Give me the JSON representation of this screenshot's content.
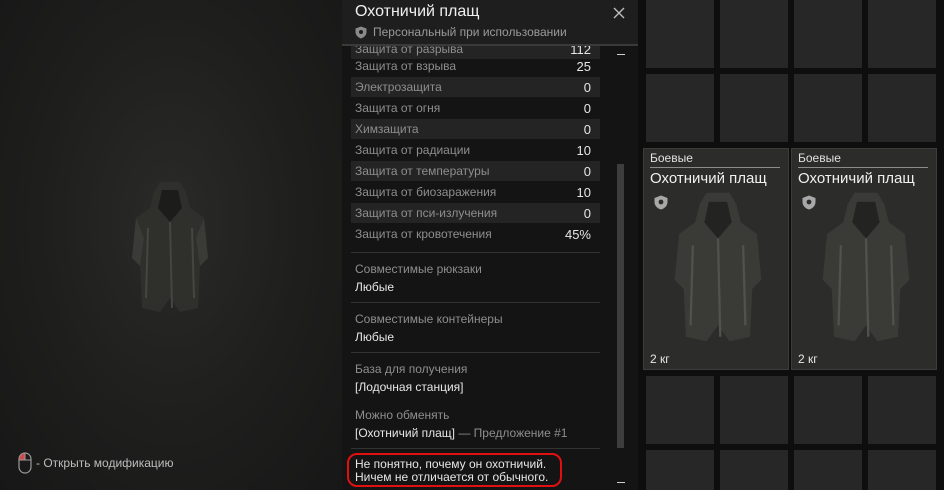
{
  "preview": {
    "mouse_hint": "- Открыть модификацию"
  },
  "panel": {
    "title": "Охотничий плащ",
    "subtitle": "Персональный при использовании",
    "stats": [
      {
        "name": "Защита от разрыва",
        "value": "112"
      },
      {
        "name": "Защита от взрыва",
        "value": "25"
      },
      {
        "name": "Электрозащита",
        "value": "0"
      },
      {
        "name": "Защита от огня",
        "value": "0"
      },
      {
        "name": "Химзащита",
        "value": "0"
      },
      {
        "name": "Защита от радиации",
        "value": "10"
      },
      {
        "name": "Защита от температуры",
        "value": "0"
      },
      {
        "name": "Защита от биозаражения",
        "value": "10"
      },
      {
        "name": "Защита от пси-излучения",
        "value": "0"
      },
      {
        "name": "Защита от кровотечения",
        "value": "45%"
      }
    ],
    "backpacks": {
      "label": "Совместимые рюкзаки",
      "value": "Любые"
    },
    "containers": {
      "label": "Совместимые контейнеры",
      "value": "Любые"
    },
    "source": {
      "label": "База для получения",
      "value": "[Лодочная станция]"
    },
    "exchange": {
      "label": "Можно обменять",
      "value": "[Охотничий плащ]",
      "suffix": " — Предложение #1"
    },
    "note": {
      "line1": "Не понятно, почему он охотничий.",
      "line2": "Ничем не отличается от обычного."
    }
  },
  "inventory": {
    "items": [
      {
        "category": "Боевые",
        "name": "Охотничий плащ",
        "weight": "2 кг"
      },
      {
        "category": "Боевые",
        "name": "Охотничий плащ",
        "weight": "2 кг"
      }
    ]
  },
  "colors": {
    "accent_red": "#e01010",
    "panel_bg": "#141414",
    "row_alt": "#242424"
  }
}
